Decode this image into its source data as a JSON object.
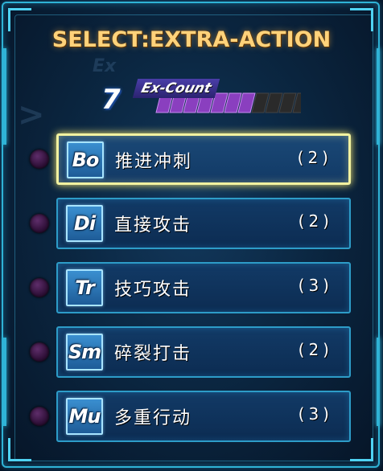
{
  "title": "SELECT:EXTRA-ACTION",
  "ex_count": {
    "value": "7",
    "label": "Ex-Count",
    "filled_segments": 7,
    "total_segments": 11
  },
  "actions": [
    {
      "code": "Bo",
      "name": "推进冲刺",
      "cost": "(2)",
      "selected": true
    },
    {
      "code": "Di",
      "name": "直接攻击",
      "cost": "(2)",
      "selected": false
    },
    {
      "code": "Tr",
      "name": "技巧攻击",
      "cost": "(3)",
      "selected": false
    },
    {
      "code": "Sm",
      "name": "碎裂打击",
      "cost": "(2)",
      "selected": false
    },
    {
      "code": "Mu",
      "name": "多重行动",
      "cost": "(3)",
      "selected": false
    }
  ],
  "colors": {
    "frame": "#2fb3d6",
    "title": "#ffd27a",
    "selected_border": "#f2f2a0",
    "bar_fill": "#8a3fbf",
    "bar_empty": "#2a2a2a"
  },
  "icons": {
    "selection_indicator": "purple-dot-icon"
  }
}
